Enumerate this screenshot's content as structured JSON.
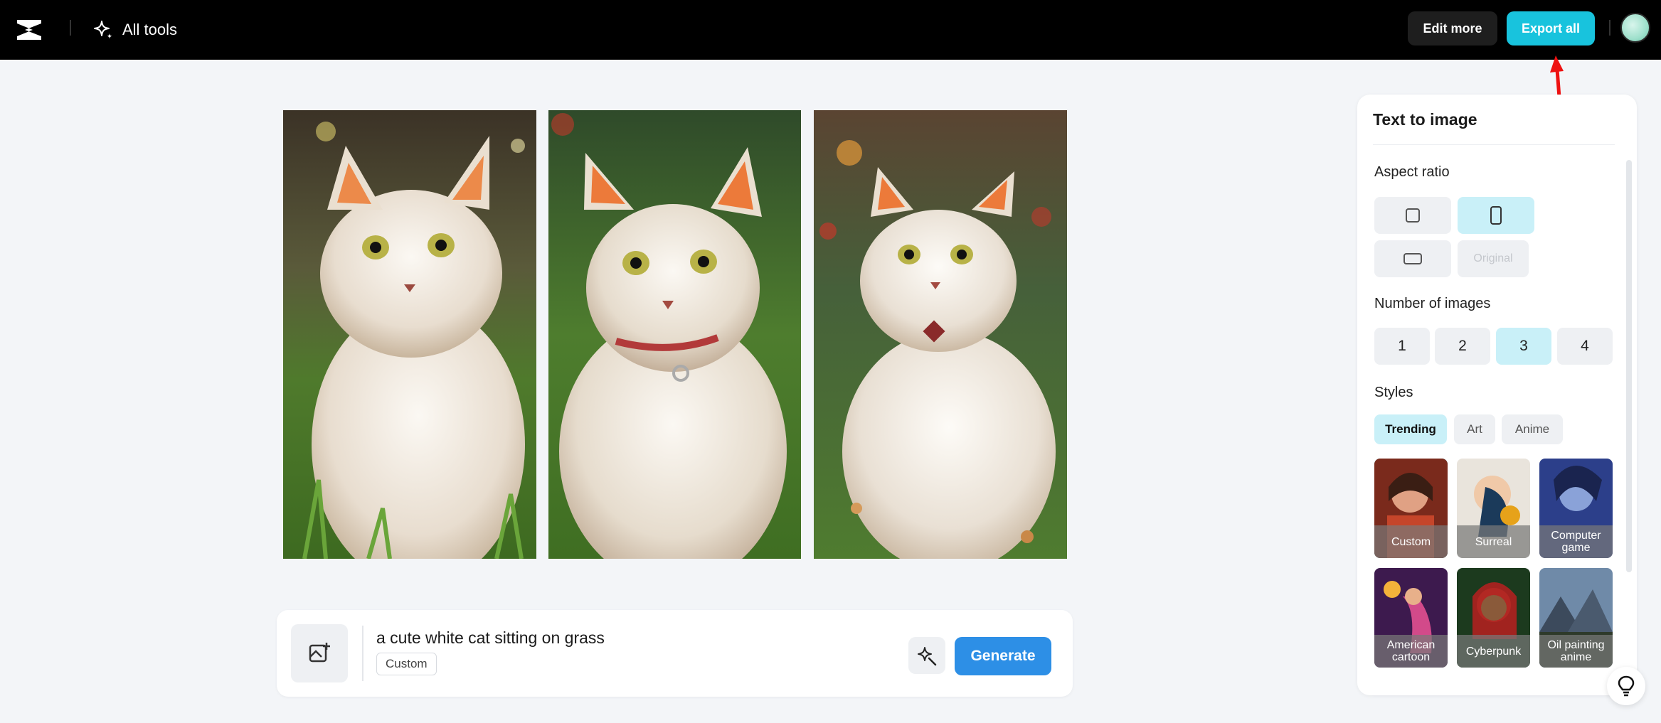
{
  "header": {
    "logo_icon": "capcut-logo-icon",
    "all_tools_label": "All tools",
    "edit_more_label": "Edit more",
    "export_all_label": "Export all",
    "accent_color": "#18c3dd"
  },
  "gallery": {
    "images": [
      {
        "alt_icon": "cat-image-1"
      },
      {
        "alt_icon": "cat-image-2"
      },
      {
        "alt_icon": "cat-image-3"
      }
    ]
  },
  "prompt_bar": {
    "prompt_text": "a cute white cat sitting on grass",
    "style_tag": "Custom",
    "generate_label": "Generate",
    "generate_color": "#2d8fe6"
  },
  "panel": {
    "title": "Text to image",
    "aspect_ratio": {
      "label": "Aspect ratio",
      "options": [
        "square",
        "portrait",
        "landscape",
        "Original"
      ],
      "selected": "portrait"
    },
    "number_of_images": {
      "label": "Number of images",
      "options": [
        "1",
        "2",
        "3",
        "4"
      ],
      "selected": "3"
    },
    "styles": {
      "label": "Styles",
      "tabs": [
        "Trending",
        "Art",
        "Anime"
      ],
      "selected_tab": "Trending",
      "items": [
        {
          "name": "Custom"
        },
        {
          "name": "Surreal"
        },
        {
          "name": "Computer game"
        },
        {
          "name": "American cartoon"
        },
        {
          "name": "Cyberpunk"
        },
        {
          "name": "Oil painting anime"
        }
      ],
      "selected_item": "Custom"
    }
  }
}
